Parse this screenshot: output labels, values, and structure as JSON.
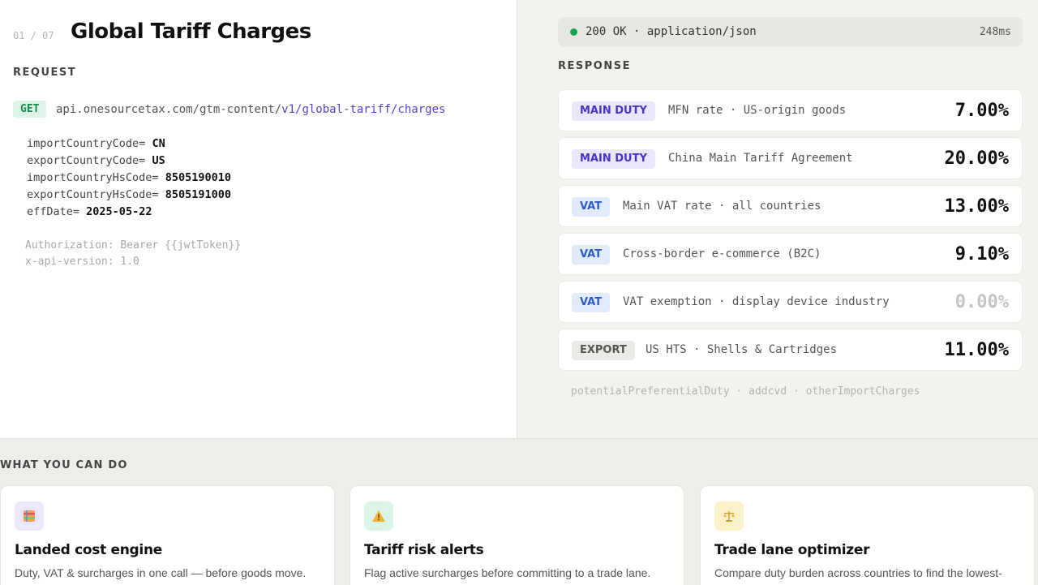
{
  "header": {
    "counter": "01 / 07",
    "title": "Global Tariff Charges"
  },
  "request": {
    "label": "REQUEST",
    "method": "GET",
    "url_base": "api.onesourcetax.com/gtm-content/",
    "url_path": "v1/global-tariff/charges",
    "params": [
      {
        "key": "importCountryCode=",
        "value": "CN"
      },
      {
        "key": "exportCountryCode=",
        "value": "US"
      },
      {
        "key": "importCountryHsCode=",
        "value": "8505190010"
      },
      {
        "key": "exportCountryHsCode=",
        "value": "8505191000"
      },
      {
        "key": "effDate=",
        "value": "2025-05-22"
      }
    ],
    "headers": [
      "Authorization: Bearer {{jwtToken}}",
      "x-api-version: 1.0"
    ]
  },
  "response": {
    "status": "200 OK · application/json",
    "time": "248ms",
    "label": "RESPONSE",
    "rows": [
      {
        "badge": "MAIN DUTY",
        "type": "duty",
        "desc": "MFN rate · US-origin goods",
        "value": "7.00%"
      },
      {
        "badge": "MAIN DUTY",
        "type": "duty",
        "desc": "China Main Tariff Agreement",
        "value": "20.00%"
      },
      {
        "badge": "VAT",
        "type": "vat",
        "desc": "Main VAT rate · all countries",
        "value": "13.00%"
      },
      {
        "badge": "VAT",
        "type": "vat",
        "desc": "Cross-border e-commerce (B2C)",
        "value": "9.10%"
      },
      {
        "badge": "VAT",
        "type": "vat",
        "desc": "VAT exemption · display device industry",
        "value": "0.00%"
      },
      {
        "badge": "EXPORT",
        "type": "export",
        "desc": "US HTS · Shells & Cartridges",
        "value": "11.00%"
      }
    ],
    "footer_fields": "potentialPreferentialDuty · addcvd · otherImportCharges"
  },
  "features": {
    "label": "WHAT YOU CAN DO",
    "cards": [
      {
        "icon": "ledger-icon",
        "title": "Landed cost engine",
        "desc": "Duty, VAT & surcharges in one call — before goods move."
      },
      {
        "icon": "warning-icon",
        "title": "Tariff risk alerts",
        "desc": "Flag active surcharges before committing to a trade lane."
      },
      {
        "icon": "scale-icon",
        "title": "Trade lane optimizer",
        "desc": "Compare duty burden across countries to find the lowest-"
      }
    ]
  }
}
